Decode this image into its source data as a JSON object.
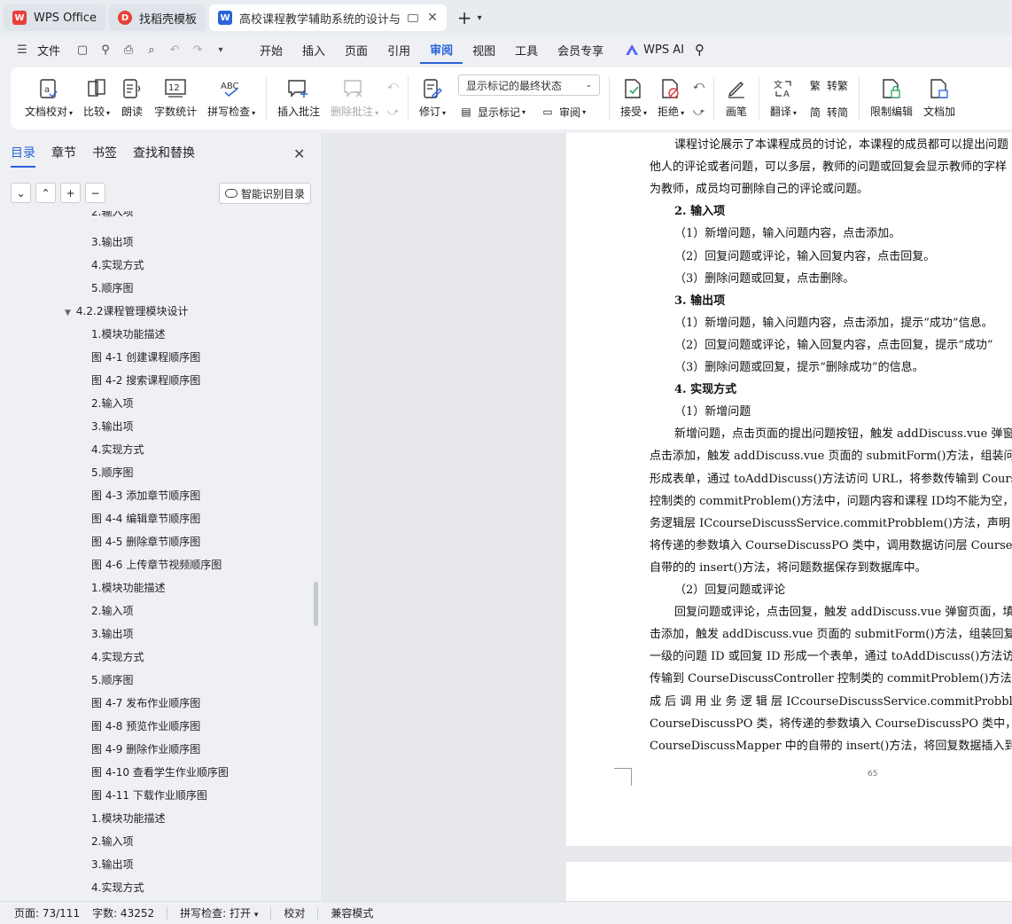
{
  "tabs": [
    {
      "label": "WPS Office",
      "logo": "W"
    },
    {
      "label": "找稻壳模板",
      "logo": "D"
    },
    {
      "label": "高校课程教学辅助系统的设计与",
      "logo": "W"
    }
  ],
  "menu": {
    "file_label": "文件",
    "tabs": [
      "开始",
      "插入",
      "页面",
      "引用",
      "审阅",
      "视图",
      "工具",
      "会员专享"
    ],
    "active_tab": "审阅",
    "ai_label": "WPS AI"
  },
  "ribbon": {
    "proofread": "文档校对",
    "compare": "比较",
    "read_aloud": "朗读",
    "word_count": "字数统计",
    "spell_check": "拼写检查",
    "insert_comment": "插入批注",
    "delete_comment": "删除批注",
    "revise": "修订",
    "markup_dropdown": "显示标记的最终状态",
    "show_markup": "显示标记",
    "review": "审阅",
    "accept": "接受",
    "reject": "拒绝",
    "pen": "画笔",
    "translate": "翻译",
    "to_traditional": "转繁",
    "to_simplified": "转简",
    "restrict_edit": "限制编辑",
    "doc_add": "文档加"
  },
  "nav": {
    "tabs": [
      "目录",
      "章节",
      "书签",
      "查找和替换"
    ],
    "active_tab": "目录",
    "smart_toc": "智能识别目录",
    "items": [
      {
        "text": "2.输入项",
        "level": 3
      },
      {
        "text": "3.输出项",
        "level": 3
      },
      {
        "text": "4.实现方式",
        "level": 3
      },
      {
        "text": "5.顺序图",
        "level": 3
      },
      {
        "text": "4.2.2课程管理模块设计",
        "level": 2,
        "expanded": true
      },
      {
        "text": "1.模块功能描述",
        "level": 3
      },
      {
        "text": "图 4-1  创建课程顺序图",
        "level": 3
      },
      {
        "text": "图 4-2  搜索课程顺序图",
        "level": 3
      },
      {
        "text": "2.输入项",
        "level": 3
      },
      {
        "text": "3.输出项",
        "level": 3
      },
      {
        "text": "4.实现方式",
        "level": 3
      },
      {
        "text": "5.顺序图",
        "level": 3
      },
      {
        "text": "图 4-3  添加章节顺序图",
        "level": 3
      },
      {
        "text": "图 4-4  编辑章节顺序图",
        "level": 3
      },
      {
        "text": "图 4-5  删除章节顺序图",
        "level": 3
      },
      {
        "text": "图 4-6  上传章节视频顺序图",
        "level": 3
      },
      {
        "text": "1.模块功能描述",
        "level": 3
      },
      {
        "text": "2.输入项",
        "level": 3
      },
      {
        "text": "3.输出项",
        "level": 3
      },
      {
        "text": "4.实现方式",
        "level": 3
      },
      {
        "text": "5.顺序图",
        "level": 3
      },
      {
        "text": "图 4-7  发布作业顺序图",
        "level": 3
      },
      {
        "text": "图 4-8  预览作业顺序图",
        "level": 3
      },
      {
        "text": "图 4-9  删除作业顺序图",
        "level": 3
      },
      {
        "text": "图 4-10  查看学生作业顺序图",
        "level": 3
      },
      {
        "text": "图 4-11  下载作业顺序图",
        "level": 3
      },
      {
        "text": "1.模块功能描述",
        "level": 3
      },
      {
        "text": "2.输入项",
        "level": 3
      },
      {
        "text": "3.输出项",
        "level": 3
      },
      {
        "text": "4.实现方式",
        "level": 3
      }
    ]
  },
  "document": {
    "lines": [
      {
        "text": "课程讨论展示了本课程成员的讨论，本课程的成员都可以提出问题",
        "indent": true
      },
      {
        "text": "他人的评论或者问题，可以多层，教师的问题或回复会显示教师的字样"
      },
      {
        "text": "为教师，成员均可删除自己的评论或问题。"
      },
      {
        "text": "2. 输入项",
        "bold": true,
        "indent": true
      },
      {
        "text": "（1）新增问题，输入问题内容，点击添加。",
        "indent": true
      },
      {
        "text": "（2）回复问题或评论，输入回复内容，点击回复。",
        "indent": true
      },
      {
        "text": "（3）删除问题或回复，点击删除。",
        "indent": true
      },
      {
        "text": "3. 输出项",
        "bold": true,
        "indent": true
      },
      {
        "text": "（1）新增问题，输入问题内容，点击添加，提示“成功”信息。",
        "indent": true
      },
      {
        "text": "（2）回复问题或评论，输入回复内容，点击回复，提示“成功”",
        "indent": true
      },
      {
        "text": "（3）删除问题或回复，提示“删除成功”的信息。",
        "indent": true
      },
      {
        "text": "4. 实现方式",
        "bold": true,
        "indent": true
      },
      {
        "text": "（1）新增问题",
        "indent": true
      },
      {
        "text": "新增问题，点击页面的提出问题按钮，触发 addDiscuss.vue 弹窗页面",
        "indent": true
      },
      {
        "text": "点击添加，触发 addDiscuss.vue 页面的 submitForm()方法，组装问题"
      },
      {
        "text": "形成表单，通过 toAddDiscuss()方法访问 URL，将参数传输到 CourseD"
      },
      {
        "text": "控制类的 commitProblem()方法中，问题内容和课程 ID均不能为空，村"
      },
      {
        "text": "务逻辑层 ICcourseDiscussService.commitProbblem()方法，声明 CourseD"
      },
      {
        "text": "将传递的参数填入 CourseDiscussPO 类中，调用数据访问层 CourseDi"
      },
      {
        "text": "自带的的 insert()方法，将问题数据保存到数据库中。"
      },
      {
        "text": "（2）回复问题或评论",
        "indent": true
      },
      {
        "text": "回复问题或评论，点击回复，触发 addDiscuss.vue 弹窗页面，填",
        "indent": true
      },
      {
        "text": "击添加，触发 addDiscuss.vue 页面的 submitForm()方法，组装回复内容"
      },
      {
        "text": "一级的问题 ID 或回复 ID 形成一个表单，通过 toAddDiscuss()方法访问"
      },
      {
        "text": "传输到 CourseDiscussController 控制类的 commitProblem()方法中，校"
      },
      {
        "text": "成 后 调 用 业 务 逻 辑 层 ICcourseDiscussService.commitProbblem() 方"
      },
      {
        "text": "CourseDiscussPO 类，将传递的参数填入  CourseDiscussPO 类中，调用"
      },
      {
        "text": "CourseDiscussMapper 中的自带的  insert()方法，将回复数据插入到数据"
      }
    ],
    "page_number": "65"
  },
  "status": {
    "page": "页面: 73/111",
    "words": "字数: 43252",
    "spell": "拼写检查: 打开",
    "proof": "校对",
    "compat": "兼容模式"
  },
  "colors": {
    "accent": "#2b63d9",
    "wps_red": "#e8403a"
  }
}
